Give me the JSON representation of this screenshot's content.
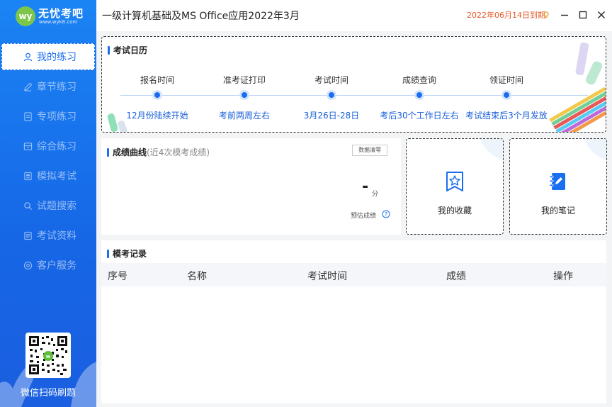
{
  "sidebar": {
    "logo": {
      "badge": "wy",
      "name": "无忧考吧",
      "url": "www.wyk8.com"
    },
    "items": [
      {
        "label": "我的练习",
        "icon": "user-icon",
        "active": true
      },
      {
        "label": "章节练习",
        "icon": "edit-icon",
        "active": false
      },
      {
        "label": "专项练习",
        "icon": "document-icon",
        "active": false
      },
      {
        "label": "综合练习",
        "icon": "archive-icon",
        "active": false
      },
      {
        "label": "模拟考试",
        "icon": "exam-icon",
        "active": false
      },
      {
        "label": "试题搜索",
        "icon": "search-icon",
        "active": false
      },
      {
        "label": "考试资料",
        "icon": "folder-icon",
        "active": false
      },
      {
        "label": "客户服务",
        "icon": "service-icon",
        "active": false
      }
    ],
    "qr_caption": "微信扫码刷题"
  },
  "titlebar": {
    "title": "一级计算机基础及MS Office应用2022年3月",
    "expiry": "2022年06月14日到期",
    "icons": [
      "bulb-icon",
      "minimize-icon",
      "maximize-icon",
      "close-icon"
    ]
  },
  "calendar": {
    "title": "考试日历",
    "steps": [
      {
        "name": "报名时间",
        "date": "12月份陆续开始"
      },
      {
        "name": "准考证打印",
        "date": "考前两周左右"
      },
      {
        "name": "考试时间",
        "date": "3月26日-28日"
      },
      {
        "name": "成绩查询",
        "date": "考后30个工作日左右"
      },
      {
        "name": "领证时间",
        "date": "考试结束后3个月发放"
      }
    ]
  },
  "score": {
    "title": "成绩曲线",
    "subtitle": "(近4次模考成绩)",
    "clear_label": "数据清零",
    "value": "-",
    "unit": "分",
    "estimate_label": "预估成绩"
  },
  "cards": [
    {
      "label": "我的收藏",
      "icon": "favorite-star-icon"
    },
    {
      "label": "我的笔记",
      "icon": "notebook-icon"
    }
  ],
  "records": {
    "title": "模考记录",
    "columns": [
      "序号",
      "名称",
      "考试时间",
      "成绩",
      "操作"
    ]
  },
  "colors": {
    "accent": "#1a6ef0",
    "sidebar": "#1b84f4",
    "expiry": "#e55b2b"
  }
}
